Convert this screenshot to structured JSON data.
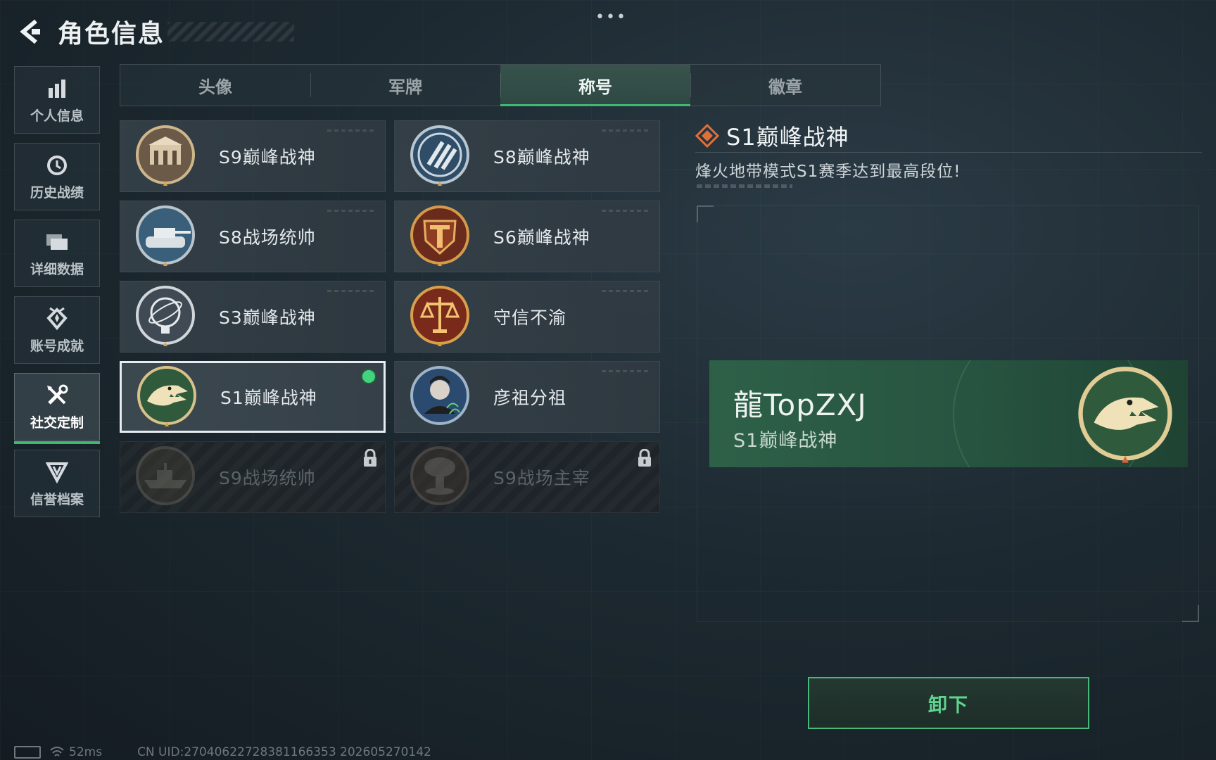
{
  "header": {
    "title": "角色信息",
    "more": "•••"
  },
  "sidebar": {
    "items": [
      {
        "label": "个人信息"
      },
      {
        "label": "历史战绩"
      },
      {
        "label": "详细数据"
      },
      {
        "label": "账号成就"
      },
      {
        "label": "社交定制"
      },
      {
        "label": "信誉档案"
      }
    ],
    "active_index": 4
  },
  "tabs": [
    {
      "label": "头像"
    },
    {
      "label": "军牌"
    },
    {
      "label": "称号"
    },
    {
      "label": "徽章"
    }
  ],
  "active_tab": "称号",
  "titles": [
    {
      "label": "S9巅峰战神",
      "state": "unlocked",
      "icon": "fortress-medal-icon"
    },
    {
      "label": "S8巅峰战神",
      "state": "unlocked",
      "icon": "slash-emblem-medal-icon"
    },
    {
      "label": "S8战场统帅",
      "state": "unlocked",
      "icon": "tank-medal-icon"
    },
    {
      "label": "S6巅峰战神",
      "state": "unlocked",
      "icon": "shield-t-medal-icon"
    },
    {
      "label": "S3巅峰战神",
      "state": "unlocked",
      "icon": "globe-medal-icon"
    },
    {
      "label": "守信不渝",
      "state": "unlocked",
      "icon": "scales-medal-icon"
    },
    {
      "label": "S1巅峰战神",
      "state": "equipped",
      "icon": "crocodile-medal-icon"
    },
    {
      "label": "彦祖分祖",
      "state": "unlocked",
      "icon": "portrait-medal-icon"
    },
    {
      "label": "S9战场统帅",
      "state": "locked",
      "icon": "warship-medal-icon"
    },
    {
      "label": "S9战场主宰",
      "state": "locked",
      "icon": "mushroom-cloud-medal-icon"
    }
  ],
  "detail": {
    "title": "S1巅峰战神",
    "description": "烽火地带模式S1赛季达到最高段位!"
  },
  "preview": {
    "player_name": "龍TopZXJ",
    "title": "S1巅峰战神",
    "medal_icon": "crocodile-medal-icon"
  },
  "actions": {
    "unequip_label": "卸下"
  },
  "footer": {
    "ping": "52ms",
    "uid": "CN UID:270406227283811663​53 202605270142"
  },
  "colors": {
    "accent_green": "#3fb874",
    "equipped_dot": "#41d47d",
    "banner_bg": "#2e6048",
    "diamond_orange": "#e0703a"
  }
}
